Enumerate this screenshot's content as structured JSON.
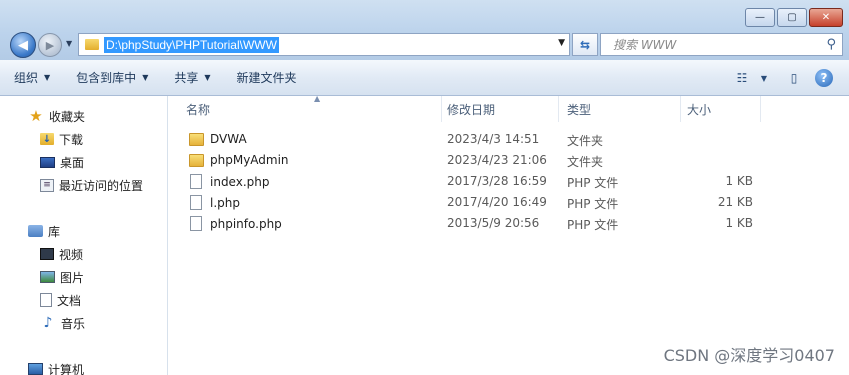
{
  "window": {
    "minimize_label": "—",
    "maximize_label": "▢",
    "close_label": "✕"
  },
  "address_bar": {
    "path": "D:\\phpStudy\\PHPTutorial\\WWW"
  },
  "search": {
    "placeholder": "搜索 WWW"
  },
  "toolbar": {
    "organize": "组织",
    "include_in_library": "包含到库中",
    "share": "共享",
    "new_folder": "新建文件夹"
  },
  "nav": {
    "favorites": "收藏夹",
    "downloads": "下载",
    "desktop": "桌面",
    "recent": "最近访问的位置",
    "libraries": "库",
    "videos": "视频",
    "pictures": "图片",
    "documents": "文档",
    "music": "音乐",
    "computer": "计算机"
  },
  "columns": {
    "name": "名称",
    "modified": "修改日期",
    "type": "类型",
    "size": "大小"
  },
  "files": [
    {
      "name": "DVWA",
      "date": "2023/4/3 14:51",
      "type": "文件夹",
      "size": "",
      "kind": "folder"
    },
    {
      "name": "phpMyAdmin",
      "date": "2023/4/23 21:06",
      "type": "文件夹",
      "size": "",
      "kind": "folder"
    },
    {
      "name": "index.php",
      "date": "2017/3/28 16:59",
      "type": "PHP 文件",
      "size": "1 KB",
      "kind": "file"
    },
    {
      "name": "l.php",
      "date": "2017/4/20 16:49",
      "type": "PHP 文件",
      "size": "21 KB",
      "kind": "file"
    },
    {
      "name": "phpinfo.php",
      "date": "2013/5/9 20:56",
      "type": "PHP 文件",
      "size": "1 KB",
      "kind": "file"
    }
  ],
  "watermark": "CSDN @深度学习0407"
}
